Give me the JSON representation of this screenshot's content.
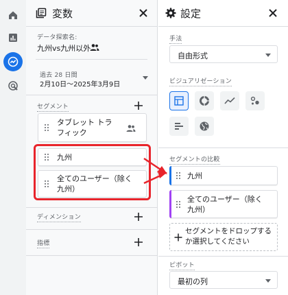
{
  "rail": {
    "items": [
      {
        "name": "home"
      },
      {
        "name": "reports"
      },
      {
        "name": "explore",
        "active": true
      },
      {
        "name": "advertising"
      }
    ]
  },
  "variables": {
    "title": "変数",
    "exploration_name_label": "データ探索名:",
    "exploration_name": "九州vs九州以外",
    "date_range_label": "過去 28 日間",
    "date_range": "2月10日〜2025年3月9日",
    "segments_label": "セグメント",
    "segments": [
      {
        "label": "タブレット トラフィック",
        "line1": "タブレット トラ",
        "line2": "フィック",
        "type": "user"
      },
      {
        "label": "九州",
        "line1": "九州",
        "line2": ""
      },
      {
        "label": "全てのユーザー（除く九州）",
        "line1": "全てのユーザー（除く",
        "line2": "九州）"
      }
    ],
    "dimensions_label": "ディメンション",
    "metrics_label": "指標"
  },
  "settings": {
    "title": "設定",
    "technique_label": "手法",
    "technique_value": "自由形式",
    "visualization_label": "ビジュアリゼーション",
    "visualizations": [
      "table",
      "donut",
      "line",
      "scatter",
      "bar",
      "geo"
    ],
    "selected_visualization": "table",
    "segment_comparison_label": "セグメントの比較",
    "comparisons": [
      {
        "line1": "九州",
        "line2": "",
        "color": "#1a73e8"
      },
      {
        "line1": "全てのユーザー（除く",
        "line2": "九州）",
        "color": "#a142f4"
      }
    ],
    "drop_line1": "セグメントをドロップする",
    "drop_line2": "か選択してください",
    "pivot_label": "ピボット",
    "pivot_value": "最初の列"
  },
  "colors": {
    "accent": "#1a73e8",
    "highlight": "#e8242b",
    "segment_purple": "#a142f4"
  }
}
